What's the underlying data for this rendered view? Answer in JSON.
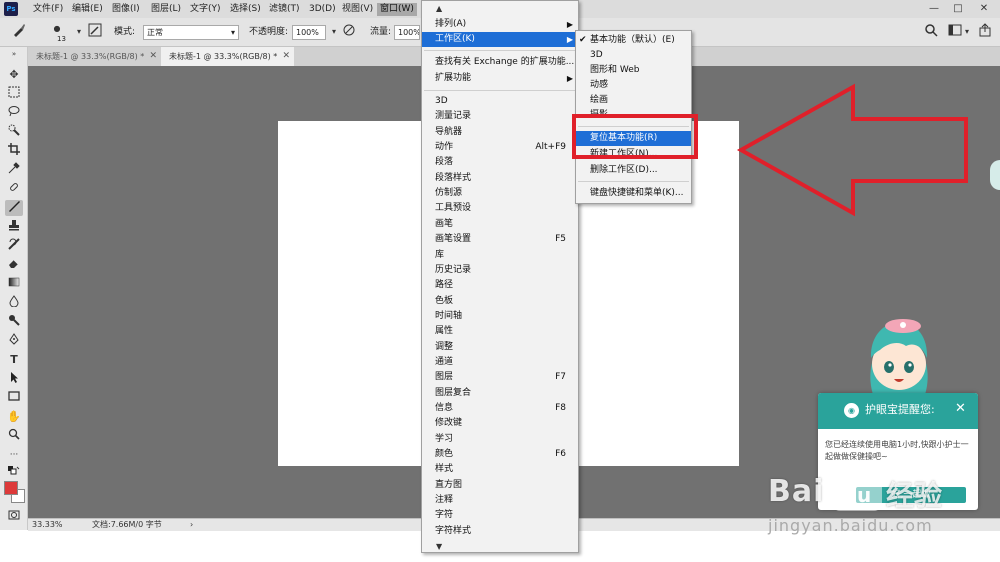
{
  "menubar": {
    "logo": "Ps",
    "items": [
      "文件(F)",
      "编辑(E)",
      "图像(I)",
      "图层(L)",
      "文字(Y)",
      "选择(S)",
      "滤镜(T)",
      "3D(D)",
      "视图(V)",
      "窗口(W)"
    ],
    "window_buttons": [
      "—",
      "□",
      "✕"
    ]
  },
  "options": {
    "brush_size": "13",
    "mode_label": "模式:",
    "mode_value": "正常",
    "opacity_label": "不透明度:",
    "opacity_value": "100%",
    "flow_label": "流量:",
    "flow_value": "100%"
  },
  "tabs": [
    "未标题-1 @ 33.3%(RGB/8) *",
    "未标题-1 @ 33.3%(RGB/8) *"
  ],
  "status": {
    "zoom": "33.33%",
    "doc_info": "文档:7.66M/0 字节"
  },
  "window_menu": {
    "top": [
      {
        "label": "排列(A)",
        "arrow": "▶"
      },
      {
        "label": "工作区(K)",
        "arrow": "▶"
      }
    ],
    "ext": [
      {
        "label": "查找有关 Exchange 的扩展功能..."
      },
      {
        "label": "扩展功能",
        "arrow": "▶"
      }
    ],
    "panels": [
      {
        "label": "3D"
      },
      {
        "label": "测量记录"
      },
      {
        "label": "导航器"
      },
      {
        "label": "动作",
        "shortcut": "Alt+F9"
      },
      {
        "label": "段落"
      },
      {
        "label": "段落样式"
      },
      {
        "label": "仿制源"
      },
      {
        "label": "工具预设"
      },
      {
        "label": "画笔"
      },
      {
        "label": "画笔设置",
        "shortcut": "F5"
      },
      {
        "label": "库"
      },
      {
        "label": "历史记录"
      },
      {
        "label": "路径"
      },
      {
        "label": "色板"
      },
      {
        "label": "时间轴"
      },
      {
        "label": "属性"
      },
      {
        "label": "调整"
      },
      {
        "label": "通道"
      },
      {
        "label": "图层",
        "shortcut": "F7"
      },
      {
        "label": "图层复合"
      },
      {
        "label": "信息",
        "shortcut": "F8"
      },
      {
        "label": "修改键"
      },
      {
        "label": "学习"
      },
      {
        "label": "颜色",
        "shortcut": "F6"
      },
      {
        "label": "样式"
      },
      {
        "label": "直方图"
      },
      {
        "label": "注释"
      },
      {
        "label": "字符"
      },
      {
        "label": "字符样式"
      }
    ]
  },
  "workspace_menu": {
    "items": [
      {
        "label": "基本功能（默认）(E)",
        "checked": "✔"
      },
      {
        "label": "3D"
      },
      {
        "label": "图形和 Web"
      },
      {
        "label": "动感"
      },
      {
        "label": "绘画"
      },
      {
        "label": "摄影"
      }
    ],
    "actions": [
      {
        "label": "复位基本功能(R)"
      },
      {
        "label": "新建工作区(N)..."
      },
      {
        "label": "删除工作区(D)..."
      }
    ],
    "keyboard": {
      "label": "键盘快捷键和菜单(K)..."
    }
  },
  "notification": {
    "title": "护眼宝提醒您:",
    "close": "✕",
    "message": "您已经连续使用电脑1小时,快跟小护士一起做做保健操吧~",
    "button": "好,一起做"
  },
  "watermark": {
    "text_bai": "Bai",
    "text_du": "du",
    "text_jingyan": "经验",
    "url": "jingyan.baidu.com"
  },
  "colors": {
    "highlight": "#1e6ed6",
    "annotation": "#e0202a",
    "canvas_bg": "#717171",
    "notify": "#2aa39b"
  }
}
